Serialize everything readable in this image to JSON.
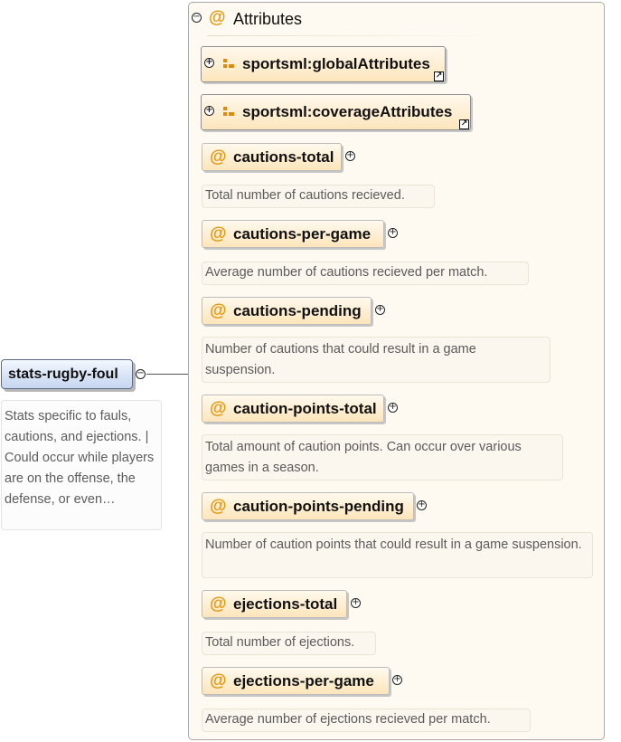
{
  "element": {
    "name": "stats-rugby-foul",
    "documentation": "Stats specific to fauls, cautions, and ejections. | Could occur while players are on the offense, the defense, or even…"
  },
  "attributes_group": {
    "symbol": "@",
    "title": "Attributes",
    "attribute_groups": [
      {
        "name": "sportsml:globalAttributes"
      },
      {
        "name": "sportsml:coverageAttributes"
      }
    ],
    "attributes": [
      {
        "name": "cautions-total",
        "doc": "Total number of cautions recieved."
      },
      {
        "name": "cautions-per-game",
        "doc": "Average number of cautions recieved per match."
      },
      {
        "name": "cautions-pending",
        "doc": "Number of cautions that could result in a game suspension."
      },
      {
        "name": "caution-points-total",
        "doc": "Total amount of caution points. Can occur over various games in a season."
      },
      {
        "name": "caution-points-pending",
        "doc": "Number of caution points that could result in a game suspension."
      },
      {
        "name": "ejections-total",
        "doc": "Total number of ejections."
      },
      {
        "name": "ejections-per-game",
        "doc": "Average number of ejections recieved per match."
      }
    ]
  },
  "icons": {
    "collapse": "minus-circle-icon",
    "expand": "plus-circle-icon",
    "reference": "reference-arrow-icon",
    "group": "attribute-group-icon"
  },
  "colors": {
    "element_fill": "#d9e4f6",
    "attribute_fill": "#fde5bb",
    "at_symbol": "#e8970d"
  }
}
